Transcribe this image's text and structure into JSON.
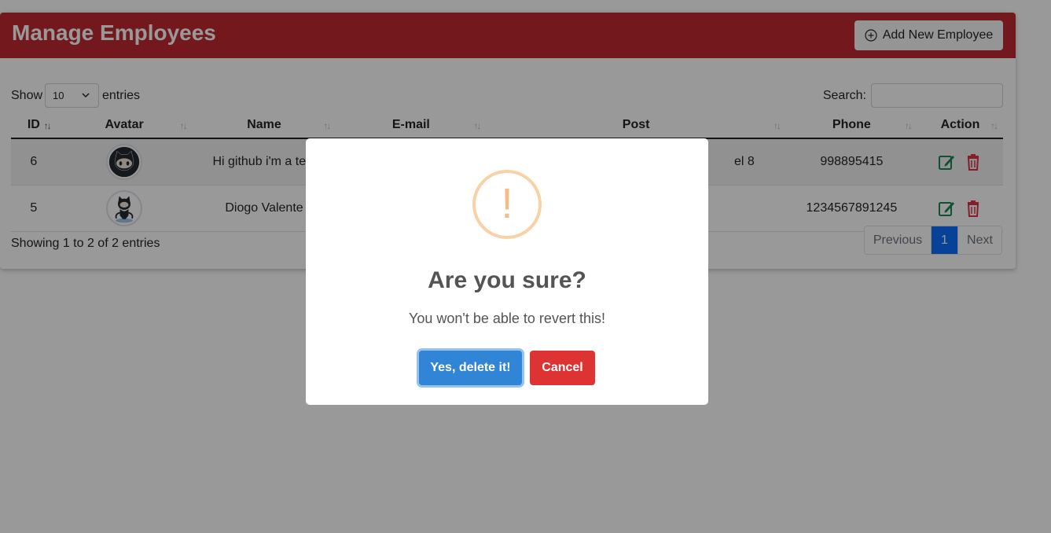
{
  "header": {
    "title": "Manage Employees",
    "add_button_label": "Add New Employee"
  },
  "controls": {
    "show_label": "Show",
    "page_length": "10",
    "entries_label": "entries",
    "search_label": "Search:",
    "search_value": ""
  },
  "table": {
    "columns": [
      "ID",
      "Avatar",
      "Name",
      "E-mail",
      "Post",
      "Phone",
      "Action"
    ],
    "rows": [
      {
        "id": "6",
        "name": "Hi github i'm a test",
        "email": "",
        "post": "el 8",
        "phone": "998895415"
      },
      {
        "id": "5",
        "name": "Diogo Valente",
        "email": "",
        "post": "",
        "phone": "1234567891245"
      }
    ]
  },
  "footer": {
    "info": "Showing 1 to 2 of 2 entries",
    "prev_label": "Previous",
    "current_page": "1",
    "next_label": "Next"
  },
  "dialog": {
    "icon_glyph": "!",
    "title": "Are you sure?",
    "text": "You won't be able to revert this!",
    "confirm_label": "Yes, delete it!",
    "cancel_label": "Cancel"
  },
  "colors": {
    "header_bg": "#c0282f",
    "edit_icon": "#198754",
    "delete_icon": "#dc3545",
    "confirm_bg": "#3085d6",
    "cancel_bg": "#dd3333",
    "warning_icon": "#f8bb86",
    "page_active": "#0d6efd"
  }
}
